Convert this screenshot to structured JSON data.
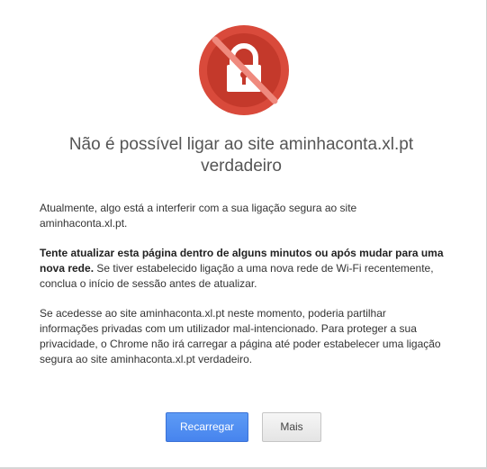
{
  "error": {
    "icon": "lock-blocked-icon",
    "title_line1": "Não é possível ligar ao site aminhaconta.xl.pt",
    "title_line2": "verdadeiro"
  },
  "body": {
    "paragraph1": "Atualmente, algo está a interferir com a sua ligação segura ao site aminhaconta.xl.pt.",
    "paragraph2_bold": "Tente atualizar esta página dentro de alguns minutos ou após mudar para uma nova rede.",
    "paragraph2_rest": " Se tiver estabelecido ligação a uma nova rede de Wi-Fi recentemente, conclua o início de sessão antes de atualizar.",
    "paragraph3": "Se acedesse ao site aminhaconta.xl.pt neste momento, poderia partilhar informações privadas com um utilizador mal-intencionado. Para proteger a sua privacidade, o Chrome não irá carregar a página até poder estabelecer uma ligação segura ao site aminhaconta.xl.pt verdadeiro."
  },
  "buttons": {
    "reload_label": "Recarregar",
    "more_label": "Mais"
  },
  "colors": {
    "icon_red": "#c0392b",
    "primary_blue": "#4d8cf0",
    "title_gray": "#555555"
  }
}
